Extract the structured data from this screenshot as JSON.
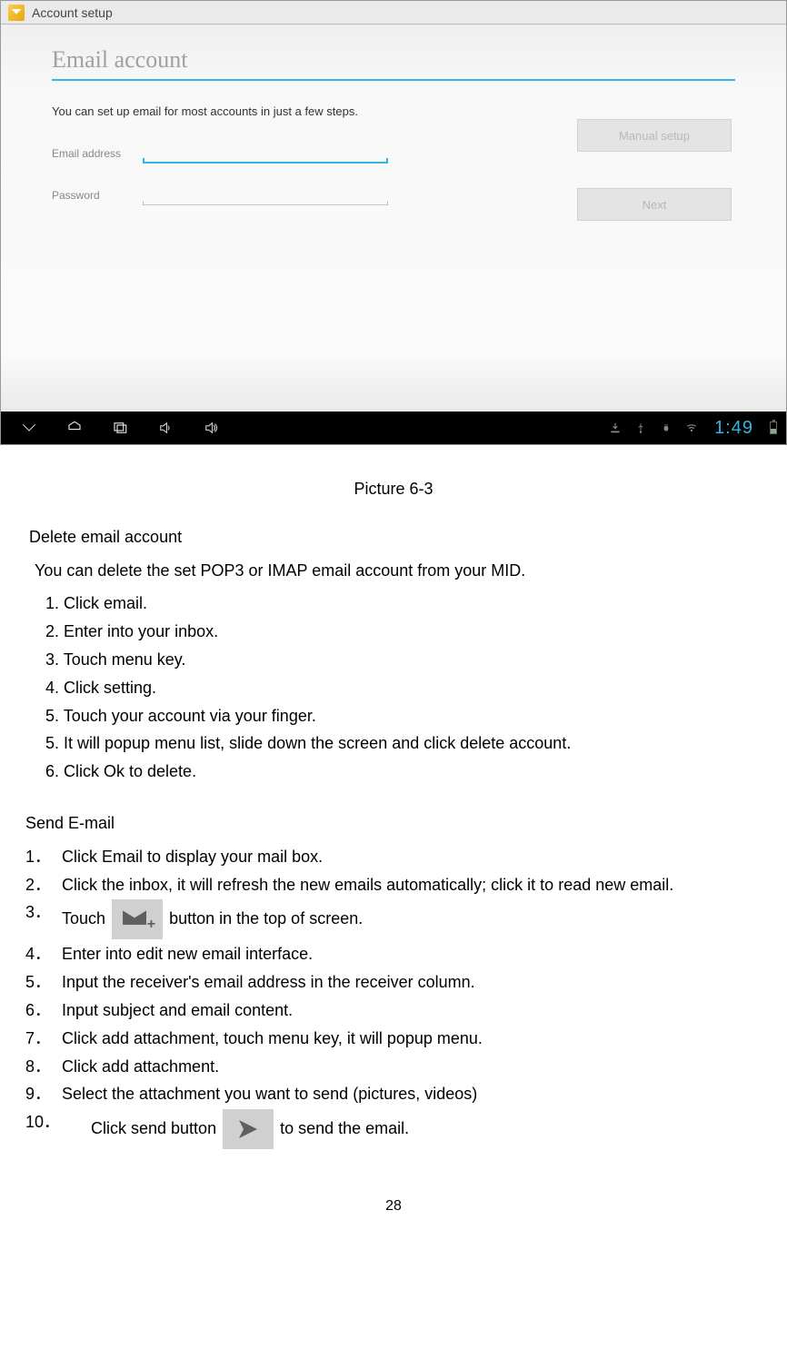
{
  "screenshot": {
    "titlebar": "Account setup",
    "card_title": "Email account",
    "card_desc": "You can set up email for most accounts in just a few steps.",
    "email_label": "Email address",
    "password_label": "Password",
    "email_value": "",
    "password_value": "",
    "manual_btn": "Manual setup",
    "next_btn": "Next",
    "clock": "1:49"
  },
  "doc": {
    "caption": "Picture 6-3",
    "section1_title": "Delete email account",
    "section1_desc": "You can delete the set POP3 or IMAP email account from your MID.",
    "section1_steps": [
      "1. Click email.",
      "2. Enter into your inbox.",
      "3. Touch menu key.",
      "4. Click setting.",
      "5. Touch your account via your finger.",
      "5. It will popup menu list, slide down the screen and click delete account.",
      "6. Click Ok to delete."
    ],
    "section2_title": "Send E-mail",
    "section2_steps": {
      "s1": {
        "num": "1．",
        "txt": "Click Email to display your mail box."
      },
      "s2": {
        "num": "2．",
        "txt": "Click the inbox, it will refresh the new emails automatically; click it to read new email."
      },
      "s3": {
        "num": "3．",
        "pre": "Touch",
        "post": " button in the top of screen."
      },
      "s4": {
        "num": "4．",
        "txt": "Enter into edit new email interface."
      },
      "s5": {
        "num": "5．",
        "txt": "Input the receiver's email address in the receiver column."
      },
      "s6": {
        "num": "6．",
        "txt": "Input subject and email content."
      },
      "s7": {
        "num": "7．",
        "txt": "Click add attachment, touch menu key, it will popup menu."
      },
      "s8": {
        "num": "8．",
        "txt": " Click add attachment."
      },
      "s9": {
        "num": "9．",
        "txt": " Select the attachment you want to send (pictures, videos)"
      },
      "s10": {
        "num": "10．",
        "pre": "Click send button ",
        "post": " to send the email."
      }
    },
    "page_num": "28"
  }
}
